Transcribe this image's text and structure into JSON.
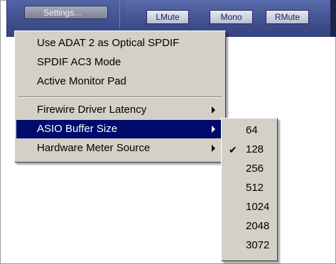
{
  "toolbar": {
    "settings_label": "Settings...",
    "lmute_label": "LMute",
    "mono_label": "Mono",
    "rmute_label": "RMute"
  },
  "settings_menu": {
    "items": [
      {
        "label": "Use ADAT 2 as Optical SPDIF"
      },
      {
        "label": "SPDIF AC3 Mode"
      },
      {
        "label": "Active Monitor Pad"
      },
      {
        "label": "Firewire Driver Latency"
      },
      {
        "label": "ASIO Buffer Size"
      },
      {
        "label": "Hardware Meter Source"
      }
    ],
    "highlighted": "ASIO Buffer Size"
  },
  "buffer_size_menu": {
    "options": [
      "64",
      "128",
      "256",
      "512",
      "1024",
      "2048",
      "3072"
    ],
    "checked": "128"
  },
  "colors": {
    "menu_background": "#d4d0c8",
    "menu_highlight": "#000a6a",
    "toolbar": "#3c4a8a"
  },
  "icons": {
    "submenu_arrow": "submenu-arrow-icon",
    "check": "checkmark-icon"
  }
}
